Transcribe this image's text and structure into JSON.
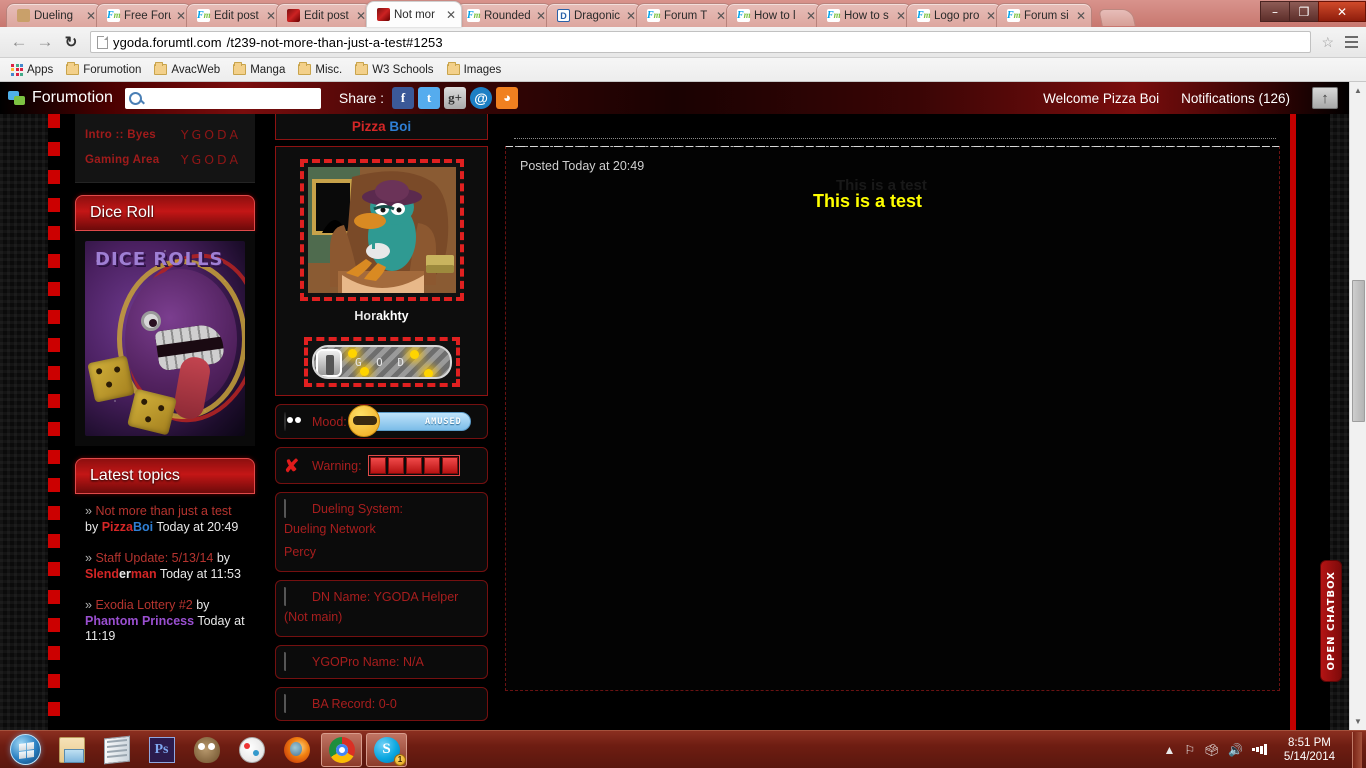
{
  "browser": {
    "tabs": [
      {
        "label": "Dueling",
        "favicon": "card-icon",
        "active": false
      },
      {
        "label": "Free Foru",
        "favicon": "forumotion-icon",
        "active": false
      },
      {
        "label": "Edit post",
        "favicon": "forumotion-icon",
        "active": false
      },
      {
        "label": "Edit post",
        "favicon": "ygoda-icon",
        "active": false
      },
      {
        "label": "Not mor",
        "favicon": "ygoda-icon",
        "active": true
      },
      {
        "label": "Rounded",
        "favicon": "forumotion-icon",
        "active": false
      },
      {
        "label": "Dragonic",
        "favicon": "d-icon",
        "active": false
      },
      {
        "label": "Forum T",
        "favicon": "forumotion-icon",
        "active": false
      },
      {
        "label": "How to l",
        "favicon": "forumotion-icon",
        "active": false
      },
      {
        "label": "How to s",
        "favicon": "forumotion-icon",
        "active": false
      },
      {
        "label": "Logo pro",
        "favicon": "forumotion-icon",
        "active": false
      },
      {
        "label": "Forum si",
        "favicon": "forumotion-icon",
        "active": false
      }
    ],
    "window_controls": {
      "minimize": "–",
      "maximize": "❐",
      "close": "✕"
    },
    "url_host": "ygoda.forumtl.com",
    "url_path": "/t239-not-more-than-just-a-test#1253",
    "bookmarks": [
      {
        "label": "Apps",
        "icon": "apps-grid-icon"
      },
      {
        "label": "Forumotion",
        "icon": "folder-icon"
      },
      {
        "label": "AvacWeb",
        "icon": "folder-icon"
      },
      {
        "label": "Manga",
        "icon": "folder-icon"
      },
      {
        "label": "Misc.",
        "icon": "folder-icon"
      },
      {
        "label": "W3 Schools",
        "icon": "folder-icon"
      },
      {
        "label": "Images",
        "icon": "folder-icon"
      }
    ]
  },
  "forumotion_bar": {
    "brand": "Forumotion",
    "search_value": "",
    "search_placeholder": "",
    "share_label": "Share :",
    "share_icons": [
      "facebook-icon",
      "twitter-icon",
      "google-plus-icon",
      "email-icon",
      "rss-icon"
    ],
    "welcome": "Welcome Pizza Boi",
    "notifications": "Notifications",
    "notifications_count": "(126)",
    "scroll_top": "↑"
  },
  "sidebar": {
    "nav_rows": [
      {
        "name": "Intro :: Byes",
        "tag": "YGODA"
      },
      {
        "name": "Gaming Area",
        "tag": "YGODA"
      }
    ],
    "dice_panel": {
      "title": "Dice Roll",
      "image_caption": "DICE ROLLS"
    },
    "latest_panel": {
      "title": "Latest topics",
      "topics": [
        {
          "chevron": "»",
          "title": "Not more than just a test",
          "by": "by",
          "author_parts": [
            "Pizza",
            "Boi"
          ],
          "date": "Today at 20:49"
        },
        {
          "chevron": "»",
          "title": "Staff Update: 5/13/14",
          "by": "by",
          "author_parts": [
            "Slend",
            "er",
            "man"
          ],
          "date": "Today at 11:53"
        },
        {
          "chevron": "»",
          "title": "Exodia Lottery #2",
          "by": "by",
          "author_single": "Phantom Princess",
          "date": "Today at 11:19"
        }
      ]
    }
  },
  "profile": {
    "username_parts": [
      "Pizza",
      " Boi"
    ],
    "avatar_alt": "perry-the-platypus-avatar",
    "rank_title_parts": [
      "Hor",
      "akhty"
    ],
    "rank_bar_text": "G O D",
    "fields": [
      {
        "icon": "mood-icon",
        "label": "Mood:",
        "value": "AMUSED",
        "type": "mood"
      },
      {
        "icon": "warning-x-icon",
        "label": "Warning:",
        "value": "",
        "type": "warning",
        "bars": 5
      },
      {
        "icon": "duel-disk-icon",
        "label": "Dueling System:",
        "lines": [
          "Dueling Network",
          "Percy"
        ],
        "type": "multiline"
      },
      {
        "icon": "duel-disk-icon",
        "label": "DN Name: YGODA Helper",
        "lines": [
          "(Not main)"
        ],
        "type": "multiline"
      },
      {
        "icon": "duel-disk-icon",
        "label": "YGOPro Name: N/A",
        "type": "single"
      },
      {
        "icon": "duel-disk-icon",
        "label": "BA Record: 0-0",
        "type": "single"
      }
    ]
  },
  "post": {
    "posted": "Posted Today at 20:49",
    "ghost_text": "This is a test",
    "body": "This is a test"
  },
  "chatbox": {
    "label": "OPEN CHATBOX"
  },
  "taskbar": {
    "start": "start-orb-icon",
    "items": [
      {
        "icon": "explorer-icon",
        "running": false
      },
      {
        "icon": "notepad-icon",
        "running": false
      },
      {
        "icon": "photoshop-icon",
        "label": "Ps",
        "running": false
      },
      {
        "icon": "gimp-icon",
        "running": false
      },
      {
        "icon": "paint-icon",
        "running": false
      },
      {
        "icon": "firefox-icon",
        "running": false
      },
      {
        "icon": "chrome-icon",
        "running": true
      },
      {
        "icon": "skype-icon",
        "label": "S",
        "running": true,
        "badge": "1"
      }
    ],
    "tray_icons": [
      "show-hidden-icons",
      "flag-icon",
      "action-center-icon",
      "volume-icon",
      "network-icon"
    ],
    "time": "8:51 PM",
    "date": "5/14/2014"
  },
  "colors": {
    "accent_red": "#c41616",
    "link_red": "#b5342f",
    "post_yellow": "#ffff00",
    "blue_name": "#2f7fd4"
  }
}
